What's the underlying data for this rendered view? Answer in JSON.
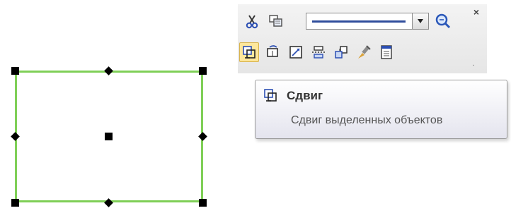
{
  "toolbar": {
    "row1": [
      {
        "name": "scissors-icon",
        "hint": "cut"
      },
      {
        "name": "copy-properties-icon",
        "hint": "copy"
      }
    ],
    "line_style": {
      "selected": "solid-line",
      "color": "#2f4d9c"
    },
    "row2": [
      {
        "name": "move-icon",
        "active": true
      },
      {
        "name": "rotate-icon"
      },
      {
        "name": "scale-icon"
      },
      {
        "name": "mirror-icon"
      },
      {
        "name": "copy-icon"
      },
      {
        "name": "format-brush-icon"
      },
      {
        "name": "properties-icon"
      }
    ],
    "close_label": "×",
    "overflow_label": "."
  },
  "tooltip": {
    "title": "Сдвиг",
    "description": "Сдвиг выделенных объектов"
  },
  "colors": {
    "selection_outline": "#7fcf57",
    "active_button": "#fde79b",
    "handle": "#000000"
  }
}
